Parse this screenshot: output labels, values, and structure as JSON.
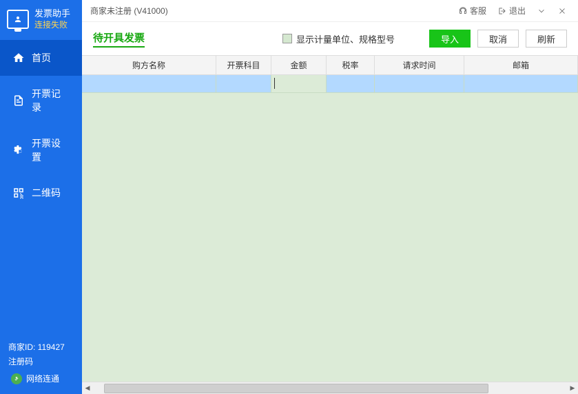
{
  "sidebar": {
    "app_title": "发票助手",
    "connection_status": "连接失败",
    "nav": [
      {
        "label": "首页"
      },
      {
        "label": "开票记录"
      },
      {
        "label": "开票设置"
      },
      {
        "label": "二维码"
      }
    ],
    "merchant_id_label": "商家ID: 119427",
    "register_code_label": "注册码",
    "network_status": "网络连通"
  },
  "titlebar": {
    "title": "商家未注册 (V41000)",
    "support_label": "客服",
    "exit_label": "退出"
  },
  "toolbar": {
    "page_title": "待开具发票",
    "checkbox_label": "显示计量单位、规格型号",
    "import_label": "导入",
    "cancel_label": "取消",
    "refresh_label": "刷新"
  },
  "table": {
    "headers": {
      "buyer": "购方名称",
      "subject": "开票科目",
      "amount": "金额",
      "rate": "税率",
      "request_time": "请求时间",
      "email": "邮箱"
    }
  }
}
